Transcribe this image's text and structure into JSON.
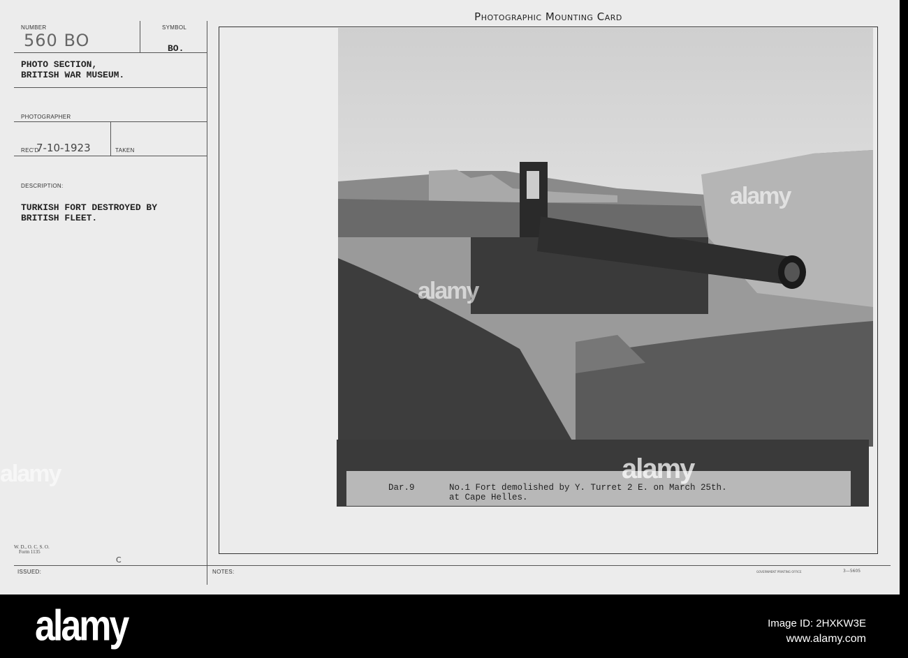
{
  "card": {
    "title": "Photographic Mounting Card",
    "number_label": "NUMBER",
    "number_value": "560 BO",
    "symbol_label": "SYMBOL",
    "symbol_value": "BO.",
    "org": [
      "PHOTO SECTION,",
      "BRITISH WAR MUSEUM."
    ],
    "photographer_label": "PHOTOGRAPHER",
    "recd_label": "REC'D",
    "recd_value": "7-10-1923",
    "taken_label": "TAKEN",
    "description_label": "DESCRIPTION:",
    "description": [
      "TURKISH FORT DESTROYED BY",
      "BRITISH FLEET."
    ],
    "form": [
      "W. D., O. C. S. O.",
      "Form 1135"
    ],
    "issued_mark": "C",
    "issued_label": "ISSUED:",
    "notes_label": "NOTES:",
    "printer": "GOVERNMENT PRINTING OFFICE",
    "printer_code": "3—5605"
  },
  "photo": {
    "caption_ref": "Dar.9",
    "caption": [
      "No.1 Fort demolished by Y. Turret 2 E. on March 25th.",
      "at Cape Helles."
    ]
  },
  "watermark": "alamy",
  "footer": {
    "logo": "alamy",
    "image_id": "Image ID: 2HXKW3E",
    "url": "www.alamy.com"
  }
}
